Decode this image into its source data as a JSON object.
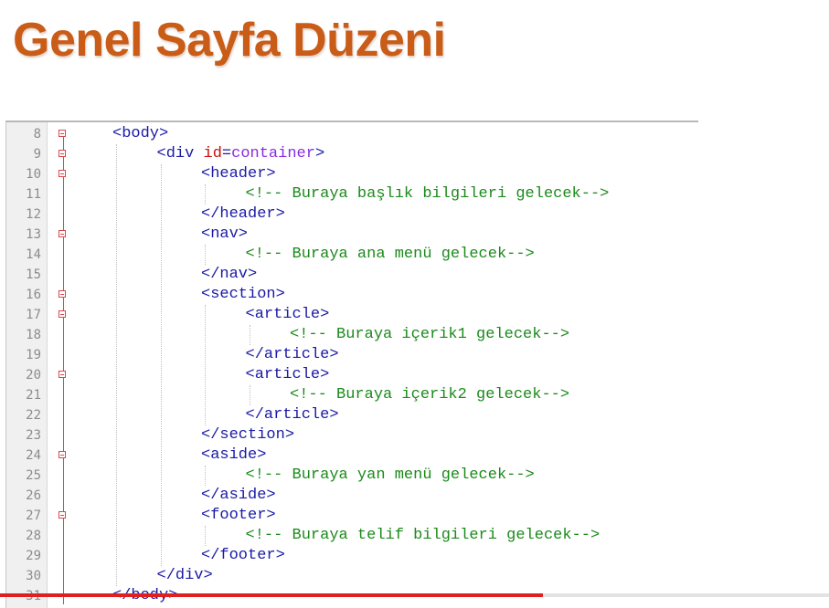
{
  "slide": {
    "title": "Genel Sayfa Düzeni",
    "title_color": "#c95c17"
  },
  "editor": {
    "colors": {
      "tag": "#1a1aa6",
      "attribute": "#c8100c",
      "value": "#8a2be2",
      "comment": "#1b8a1b"
    },
    "lines": [
      {
        "num": "8",
        "indent": 1,
        "fold": true,
        "parts": [
          {
            "t": "tag",
            "s": "<body>"
          }
        ]
      },
      {
        "num": "9",
        "indent": 2,
        "fold": true,
        "parts": [
          {
            "t": "tag",
            "s": "<div "
          },
          {
            "t": "attr",
            "s": "id"
          },
          {
            "t": "tag",
            "s": "="
          },
          {
            "t": "val",
            "s": "container"
          },
          {
            "t": "tag",
            "s": ">"
          }
        ]
      },
      {
        "num": "10",
        "indent": 3,
        "fold": true,
        "parts": [
          {
            "t": "tag",
            "s": "<header>"
          }
        ]
      },
      {
        "num": "11",
        "indent": 4,
        "fold": false,
        "parts": [
          {
            "t": "comment",
            "s": "<!-- Buraya başlık bilgileri gelecek-->"
          }
        ]
      },
      {
        "num": "12",
        "indent": 3,
        "fold": false,
        "parts": [
          {
            "t": "tag",
            "s": "</header>"
          }
        ]
      },
      {
        "num": "13",
        "indent": 3,
        "fold": true,
        "parts": [
          {
            "t": "tag",
            "s": "<nav>"
          }
        ]
      },
      {
        "num": "14",
        "indent": 4,
        "fold": false,
        "parts": [
          {
            "t": "comment",
            "s": "<!-- Buraya ana menü gelecek-->"
          }
        ]
      },
      {
        "num": "15",
        "indent": 3,
        "fold": false,
        "parts": [
          {
            "t": "tag",
            "s": "</nav>"
          }
        ]
      },
      {
        "num": "16",
        "indent": 3,
        "fold": true,
        "parts": [
          {
            "t": "tag",
            "s": "<section>"
          }
        ]
      },
      {
        "num": "17",
        "indent": 4,
        "fold": true,
        "parts": [
          {
            "t": "tag",
            "s": "<article>"
          }
        ]
      },
      {
        "num": "18",
        "indent": 5,
        "fold": false,
        "parts": [
          {
            "t": "comment",
            "s": "<!-- Buraya içerik1 gelecek-->"
          }
        ]
      },
      {
        "num": "19",
        "indent": 4,
        "fold": false,
        "parts": [
          {
            "t": "tag",
            "s": "</article>"
          }
        ]
      },
      {
        "num": "20",
        "indent": 4,
        "fold": true,
        "parts": [
          {
            "t": "tag",
            "s": "<article>"
          }
        ]
      },
      {
        "num": "21",
        "indent": 5,
        "fold": false,
        "parts": [
          {
            "t": "comment",
            "s": "<!-- Buraya içerik2 gelecek-->"
          }
        ]
      },
      {
        "num": "22",
        "indent": 4,
        "fold": false,
        "parts": [
          {
            "t": "tag",
            "s": "</article>"
          }
        ]
      },
      {
        "num": "23",
        "indent": 3,
        "fold": false,
        "parts": [
          {
            "t": "tag",
            "s": "</section>"
          }
        ]
      },
      {
        "num": "24",
        "indent": 3,
        "fold": true,
        "parts": [
          {
            "t": "tag",
            "s": "<aside>"
          }
        ]
      },
      {
        "num": "25",
        "indent": 4,
        "fold": false,
        "parts": [
          {
            "t": "comment",
            "s": "<!-- Buraya yan menü gelecek-->"
          }
        ]
      },
      {
        "num": "26",
        "indent": 3,
        "fold": false,
        "parts": [
          {
            "t": "tag",
            "s": "</aside>"
          }
        ]
      },
      {
        "num": "27",
        "indent": 3,
        "fold": true,
        "parts": [
          {
            "t": "tag",
            "s": "<footer>"
          }
        ]
      },
      {
        "num": "28",
        "indent": 4,
        "fold": false,
        "parts": [
          {
            "t": "comment",
            "s": "<!-- Buraya telif bilgileri gelecek-->"
          }
        ]
      },
      {
        "num": "29",
        "indent": 3,
        "fold": false,
        "parts": [
          {
            "t": "tag",
            "s": "</footer>"
          }
        ]
      },
      {
        "num": "30",
        "indent": 2,
        "fold": false,
        "parts": [
          {
            "t": "tag",
            "s": "</div>"
          }
        ]
      },
      {
        "num": "31",
        "indent": 1,
        "fold": false,
        "parts": [
          {
            "t": "tag",
            "s": "</body>"
          }
        ]
      }
    ]
  },
  "video_progress": {
    "fraction": 0.655,
    "color": "#e02020"
  }
}
